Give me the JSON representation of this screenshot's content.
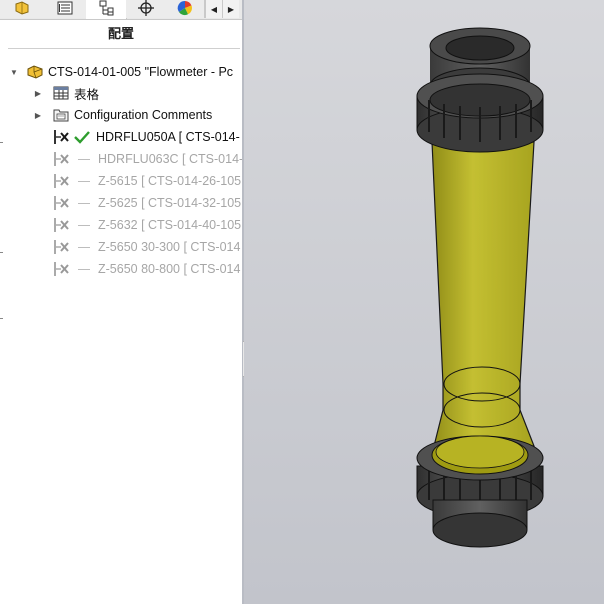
{
  "panel": {
    "title": "配置"
  },
  "tabs": [
    {
      "icon": "part-icon"
    },
    {
      "icon": "property-manager-icon"
    },
    {
      "icon": "configuration-manager-icon",
      "active": true
    },
    {
      "icon": "dimxpert-icon"
    },
    {
      "icon": "display-manager-icon"
    }
  ],
  "tree": {
    "root_label": "CTS-014-01-005 \"Flowmeter - Pc",
    "items": [
      {
        "label": "表格",
        "icon": "table-icon"
      },
      {
        "label": "Configuration Comments",
        "icon": "comments-folder-icon"
      }
    ],
    "configurations": [
      {
        "label": "HDRFLU050A [ CTS-014-",
        "active": true
      },
      {
        "label": "HDRFLU063C [ CTS-014-",
        "active": false
      },
      {
        "label": "Z-5615 [ CTS-014-26-105",
        "active": false
      },
      {
        "label": "Z-5625 [ CTS-014-32-105",
        "active": false
      },
      {
        "label": "Z-5632 [ CTS-014-40-105",
        "active": false
      },
      {
        "label": "Z-5650 30-300 [ CTS-014",
        "active": false
      },
      {
        "label": "Z-5650 80-800 [ CTS-014",
        "active": false
      }
    ]
  },
  "colors": {
    "active_check": "#2e9d2e",
    "tube_fill": "#b8b31a",
    "nut": "#4a4a4a",
    "viewport_top": "#d6d7db",
    "viewport_bottom": "#c2c4cb"
  },
  "viewport": {
    "model": "flowmeter-3d-model"
  }
}
